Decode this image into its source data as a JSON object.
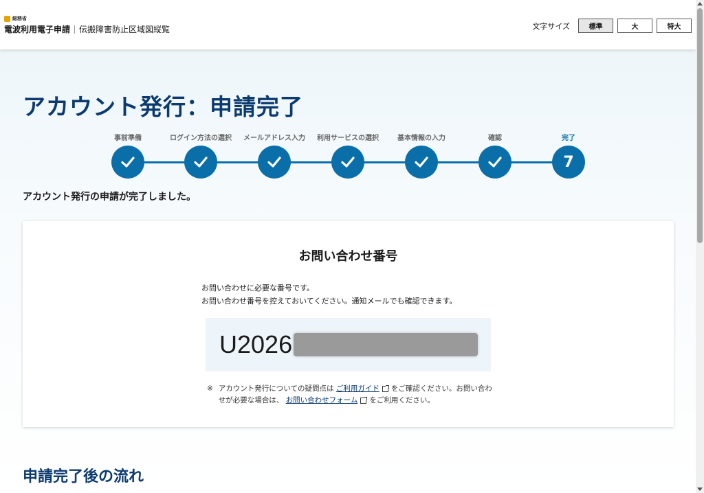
{
  "header": {
    "ministry": "総務省",
    "system": "電波利用電子申請",
    "subsystem": "伝搬障害防止区域図縦覧",
    "font_size_label": "文字サイズ",
    "font_sizes": [
      "標準",
      "大",
      "特大"
    ]
  },
  "page": {
    "title": "アカウント発行：申請完了",
    "lead": "アカウント発行の申請が完了しました。"
  },
  "steps": [
    {
      "label": "事前準備",
      "done": true
    },
    {
      "label": "ログイン方法の選択",
      "done": true
    },
    {
      "label": "メールアドレス入力",
      "done": true
    },
    {
      "label": "利用サービスの選択",
      "done": true
    },
    {
      "label": "基本情報の入力",
      "done": true
    },
    {
      "label": "確認",
      "done": true
    },
    {
      "label": "完了",
      "number": "7",
      "current": true
    }
  ],
  "inquiry": {
    "title": "お問い合わせ番号",
    "desc1": "お問い合わせに必要な番号です。",
    "desc2": "お問い合わせ番号を控えておいてください。通知メールでも確認できます。",
    "number_prefix": "U2026",
    "note_mark": "※",
    "note_text1": "アカウント発行についての疑問点は",
    "guide_link": "ご利用ガイド",
    "note_text2": "をご確認ください。お問い合わせが必要な場合は、",
    "form_link": "お問い合わせフォーム",
    "note_text3": "をご利用ください。"
  },
  "flow": {
    "title": "申請完了後の流れ"
  },
  "colors": {
    "primary": "#0a6fa8",
    "title": "#0b3a6f"
  }
}
